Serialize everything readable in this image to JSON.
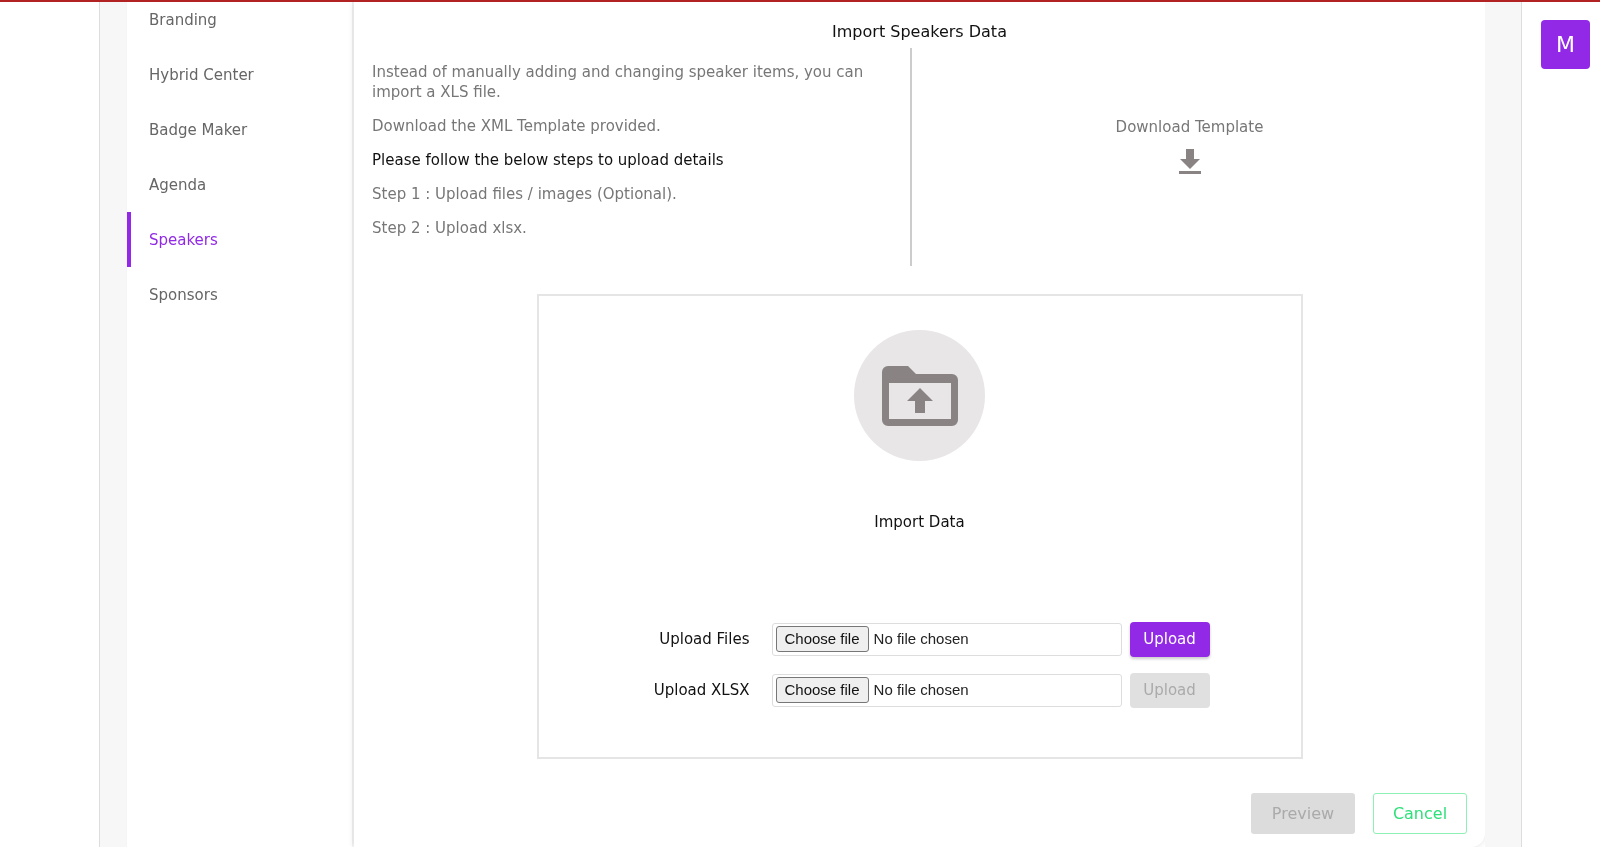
{
  "sidebar": {
    "items": [
      {
        "label": "Branding",
        "selected": false
      },
      {
        "label": "Hybrid Center",
        "selected": false
      },
      {
        "label": "Badge Maker",
        "selected": false
      },
      {
        "label": "Agenda",
        "selected": false
      },
      {
        "label": "Speakers",
        "selected": true
      },
      {
        "label": "Sponsors",
        "selected": false
      }
    ]
  },
  "title": "Import Speakers Data",
  "instructions": [
    {
      "text": "Instead of manually adding and changing speaker items, you can import a XLS file.",
      "kind": "note"
    },
    {
      "text": "Download the XML Template provided.",
      "kind": "note"
    },
    {
      "text": "Please follow the below steps to upload details",
      "kind": "heading"
    },
    {
      "text": "Step 1 : Upload files / images (Optional).",
      "kind": "note"
    },
    {
      "text": "Step 2 : Upload xlsx.",
      "kind": "note"
    }
  ],
  "download": {
    "label": "Download Template"
  },
  "import": {
    "label": "Import Data"
  },
  "uploads": [
    {
      "label": "Upload Files",
      "choose": "Choose file",
      "status": "No file chosen",
      "button": "Upload",
      "disabled": false
    },
    {
      "label": "Upload XLSX",
      "choose": "Choose file",
      "status": "No file chosen",
      "button": "Upload",
      "disabled": true
    }
  ],
  "footer": {
    "preview": {
      "label": "Preview",
      "disabled": true
    },
    "cancel": {
      "label": "Cancel"
    }
  },
  "avatar": {
    "label": "M"
  }
}
